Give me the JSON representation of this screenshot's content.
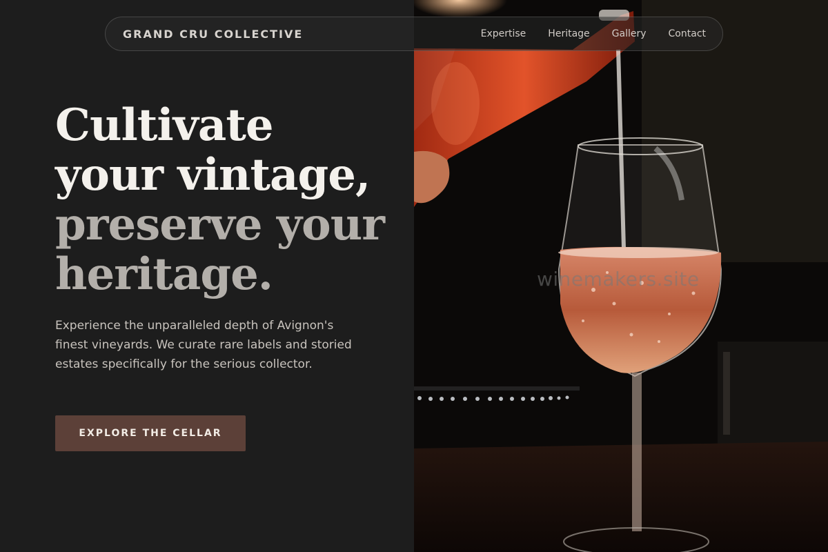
{
  "brand": "GRAND CRU COLLECTIVE",
  "nav": {
    "links": [
      "Expertise",
      "Heritage",
      "Gallery",
      "Contact"
    ]
  },
  "hero": {
    "title_line1": "Cultivate",
    "title_line2": "your vintage,",
    "title_line3": "preserve your",
    "title_line4": "heritage.",
    "description": "Experience the unparalleled depth of Avignon's finest vineyards. We curate rare labels and storied estates specifically for the serious collector.",
    "cta_label": "EXPLORE THE CELLAR"
  },
  "image": {
    "watermark": "winemakers.site",
    "subject": "rosé wine being poured into a glass"
  },
  "colors": {
    "background": "#1d1d1d",
    "cta": "#5c4038",
    "title_primary": "#f4f1ec",
    "title_secondary": "#b3afaa"
  }
}
